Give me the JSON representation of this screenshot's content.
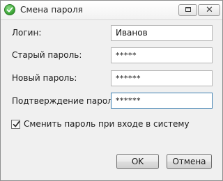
{
  "window": {
    "title": "Смена пароля",
    "icon": "checkmark-icon",
    "maximize_icon": "maximize-icon",
    "close_symbol": "✕"
  },
  "form": {
    "login": {
      "label": "Логин:",
      "value": "Иванов"
    },
    "old_password": {
      "label": "Старый пароль:",
      "value": "*****"
    },
    "new_password": {
      "label": "Новый пароль:",
      "value": "******"
    },
    "confirm_password": {
      "label": "Подтверждение пароля:",
      "value": "******"
    },
    "change_on_login": {
      "label": "Сменить пароль при входе в систему",
      "checked": true
    }
  },
  "buttons": {
    "ok": "OK",
    "cancel": "Отмена"
  },
  "colors": {
    "accent": "#3c7fb1",
    "icon_green": "#3fa83a"
  }
}
